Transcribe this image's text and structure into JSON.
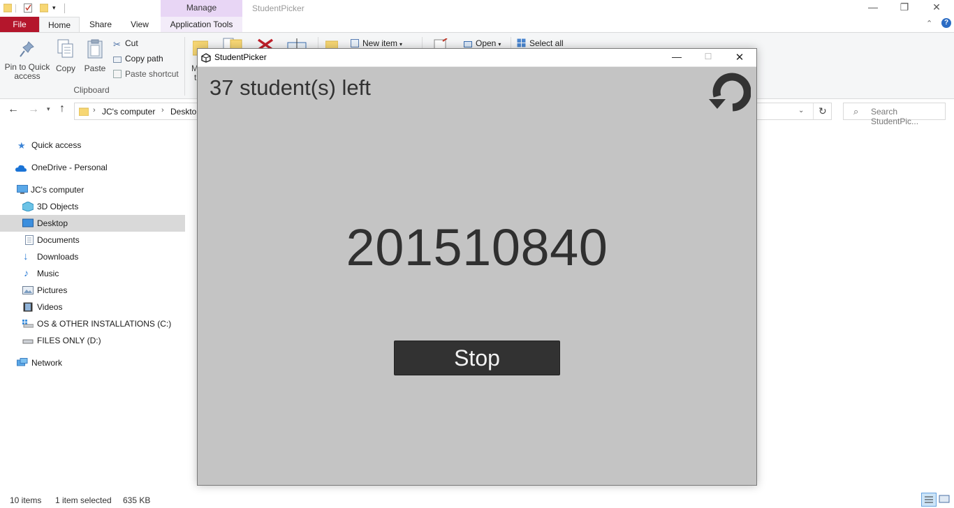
{
  "explorer": {
    "window_title": "StudentPicker",
    "context_tab_group": "Manage",
    "tabs": [
      "File",
      "Home",
      "Share",
      "View",
      "Application Tools"
    ],
    "ribbon": {
      "pin": "Pin to Quick access",
      "pin_line1": "Pin to Quick",
      "pin_line2": "access",
      "copy": "Copy",
      "paste": "Paste",
      "cut": "Cut",
      "copy_path": "Copy path",
      "paste_shortcut": "Paste shortcut",
      "group_clipboard": "Clipboard",
      "new_item": "New item",
      "open": "Open",
      "select_all": "Select all",
      "partial_m": "M",
      "partial_t": "t"
    },
    "address": {
      "crumbs": [
        "JC's computer",
        "Desktop"
      ]
    },
    "search_placeholder": "Search StudentPic...",
    "nav": {
      "quick_access": "Quick access",
      "onedrive": "OneDrive - Personal",
      "computer": "JC's computer",
      "items": [
        "3D Objects",
        "Desktop",
        "Documents",
        "Downloads",
        "Music",
        "Pictures",
        "Videos",
        "OS & OTHER INSTALLATIONS (C:)",
        "FILES ONLY (D:)"
      ],
      "network": "Network"
    },
    "status": {
      "count": "10 items",
      "selection": "1 item selected",
      "size": "635 KB"
    }
  },
  "picker": {
    "title": "StudentPicker",
    "remaining": "37 student(s) left",
    "current_number": "201510840",
    "stop_label": "Stop"
  },
  "colors": {
    "file_tab": "#b4162c",
    "manage_tab": "#e8d6f5",
    "picker_bg": "#c4c4c4",
    "stop_button": "#323232",
    "nav_selected": "#d9d9d9"
  }
}
